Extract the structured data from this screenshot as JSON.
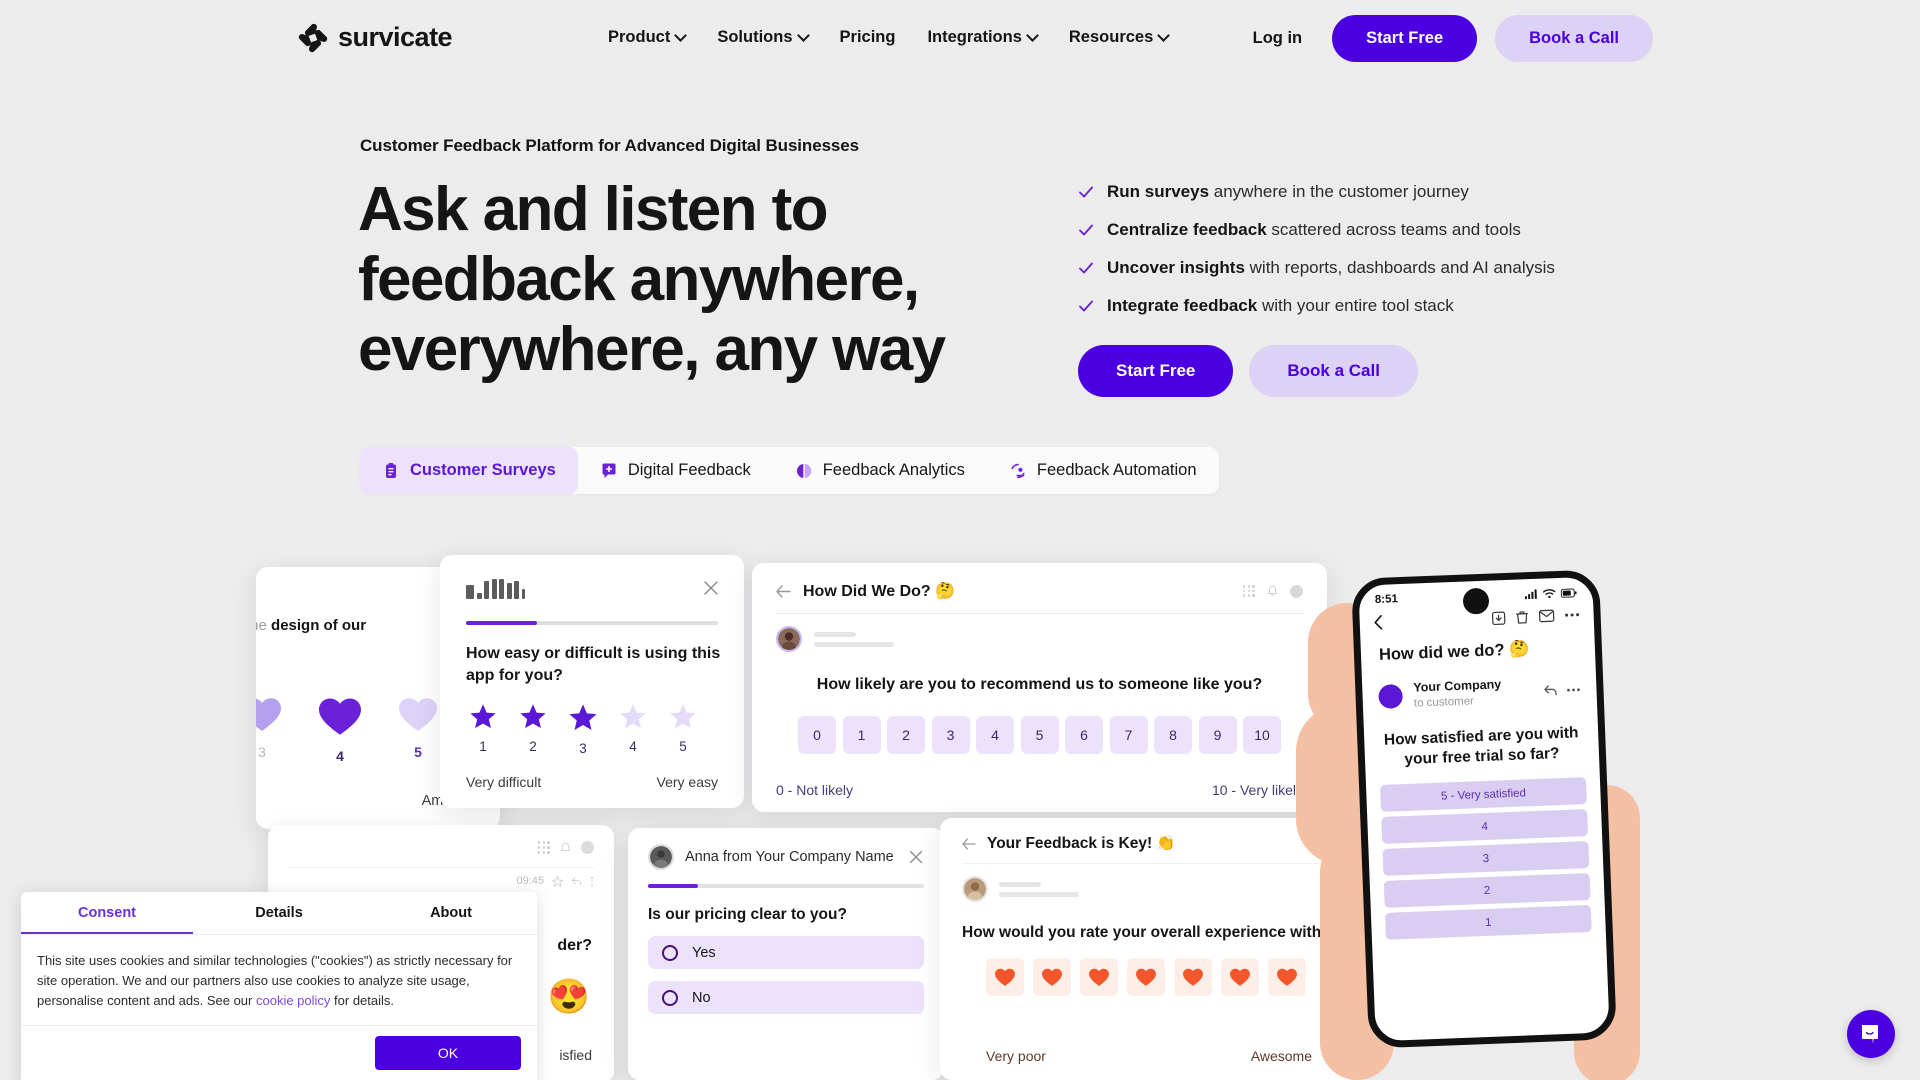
{
  "brand": {
    "name": "survicate",
    "accent": "#4a00e0",
    "accent_light": "#dcd2f5",
    "tab_active_bg": "#ece2fc"
  },
  "nav": {
    "links": [
      {
        "label": "Product",
        "has_chevron": true
      },
      {
        "label": "Solutions",
        "has_chevron": true
      },
      {
        "label": "Pricing",
        "has_chevron": false
      },
      {
        "label": "Integrations",
        "has_chevron": true
      },
      {
        "label": "Resources",
        "has_chevron": true
      }
    ],
    "login": "Log in",
    "start_free": "Start Free",
    "book_call": "Book a Call"
  },
  "hero": {
    "eyebrow": "Customer Feedback Platform for Advanced Digital Businesses",
    "title": "Ask and listen to feedback anywhere, everywhere, any way",
    "checklist": [
      {
        "bold": "Run surveys",
        "rest": " anywhere in the customer journey"
      },
      {
        "bold": "Centralize feedback",
        "rest": " scattered across teams and tools"
      },
      {
        "bold": "Uncover insights",
        "rest": " with reports, dashboards and AI analysis"
      },
      {
        "bold": "Integrate feedback",
        "rest": " with your entire tool stack"
      }
    ],
    "cta_primary": "Start Free",
    "cta_secondary": "Book a Call"
  },
  "tabs": [
    {
      "label": "Customer Surveys",
      "icon": "clipboard-icon",
      "active": true
    },
    {
      "label": "Digital Feedback",
      "icon": "chat-plus-icon",
      "active": false
    },
    {
      "label": "Feedback Analytics",
      "icon": "pie-chart-icon",
      "active": false
    },
    {
      "label": "Feedback Automation",
      "icon": "automation-icon",
      "active": false
    }
  ],
  "cards": {
    "hearts_design": {
      "question_dim": "rate the ",
      "question_bold": "design of our",
      "scale": [
        "3",
        "4",
        "5"
      ],
      "selected": "4",
      "right_label": "Amazing"
    },
    "stars_app": {
      "question": "How easy or difficult is using this app for you?",
      "scale": [
        "1",
        "2",
        "3",
        "4",
        "5"
      ],
      "filled": 3,
      "progress_pct": 28,
      "label_left": "Very difficult",
      "label_right": "Very easy"
    },
    "nps": {
      "title": "How Did We Do? 🤔",
      "question": "How likely are you to recommend us to someone like you?",
      "scale": [
        "0",
        "1",
        "2",
        "3",
        "4",
        "5",
        "6",
        "7",
        "8",
        "9",
        "10"
      ],
      "label_left": "0 - Not likely",
      "label_right": "10 - Very likely"
    },
    "hidden_emoji": {
      "question_tail": "der?",
      "timestamp": "09:45",
      "emoji": "😍",
      "label_tail": "isfied"
    },
    "pricing_yesno": {
      "sender": "Anna from Your Company Name",
      "question": "Is our pricing clear to you?",
      "options": [
        "Yes",
        "No"
      ],
      "progress_pct": 18
    },
    "feedback_key": {
      "title": "Your Feedback is Key! 👏",
      "question": "How would you rate your overall experience with our app",
      "hearts_count": 7,
      "label_left": "Very poor",
      "label_right": "Awesome"
    }
  },
  "phone": {
    "time": "8:51",
    "subject": "How did we do? 🤔",
    "sender_name": "Your Company",
    "sender_sub": "to customer",
    "question": "How satisfied are you with your free trial so far?",
    "options": [
      "5 - Very satisfied",
      "4",
      "3",
      "2",
      "1"
    ]
  },
  "cookie": {
    "tabs": [
      "Consent",
      "Details",
      "About"
    ],
    "active_tab": "Consent",
    "text_part1": "This site uses cookies and similar technologies (\"cookies\") as strictly necessary for site operation. We and our partners also use cookies to analyze site usage, personalise content and ads. See our ",
    "link": "cookie policy",
    "text_part2": " for details.",
    "ok": "OK"
  },
  "chat": {
    "icon": "chat-bubble-icon"
  }
}
